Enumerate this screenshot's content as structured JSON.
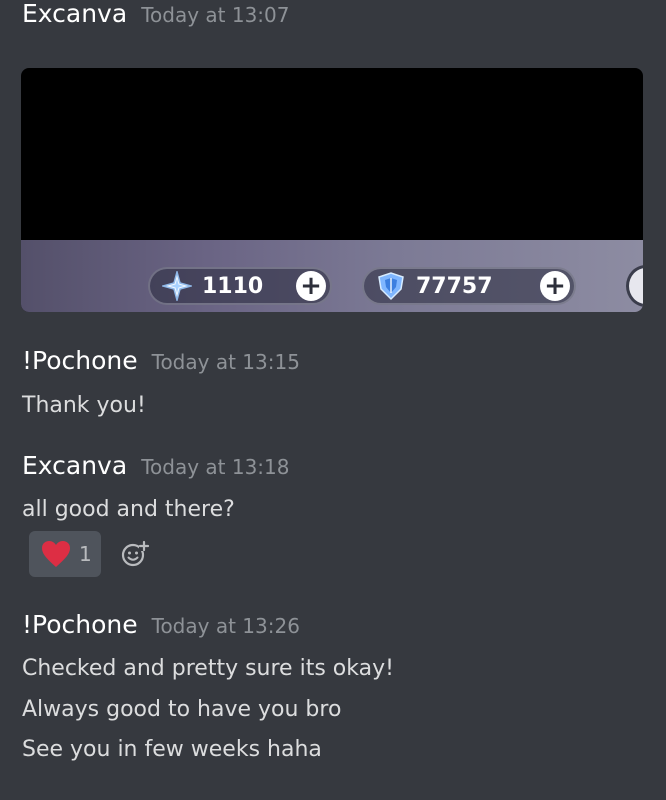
{
  "messages": [
    {
      "author": "Excanva",
      "timestamp": "Today at 13:07",
      "attachment": {
        "currencies": [
          {
            "icon": "primogem-icon",
            "value": "1110"
          },
          {
            "icon": "genesis-crystal-icon",
            "value": "77757"
          }
        ],
        "add_label": "+"
      }
    },
    {
      "author": "!Pochone",
      "timestamp": "Today at 13:15",
      "lines": [
        "Thank you!"
      ]
    },
    {
      "author": "Excanva",
      "timestamp": "Today at 13:18",
      "lines": [
        "all good and there?"
      ],
      "reactions": [
        {
          "emoji": "heart-icon",
          "count": "1",
          "color": "#dd2e44"
        }
      ]
    },
    {
      "author": "!Pochone",
      "timestamp": "Today at 13:26",
      "lines": [
        "Checked and pretty sure its okay!",
        "Always good to have you bro",
        "See you in few weeks haha"
      ]
    }
  ],
  "colors": {
    "background": "#36393f",
    "author": "#ffffff",
    "timestamp": "#8e9297",
    "text": "#dcddde",
    "reaction_bg": "#4f545c"
  }
}
